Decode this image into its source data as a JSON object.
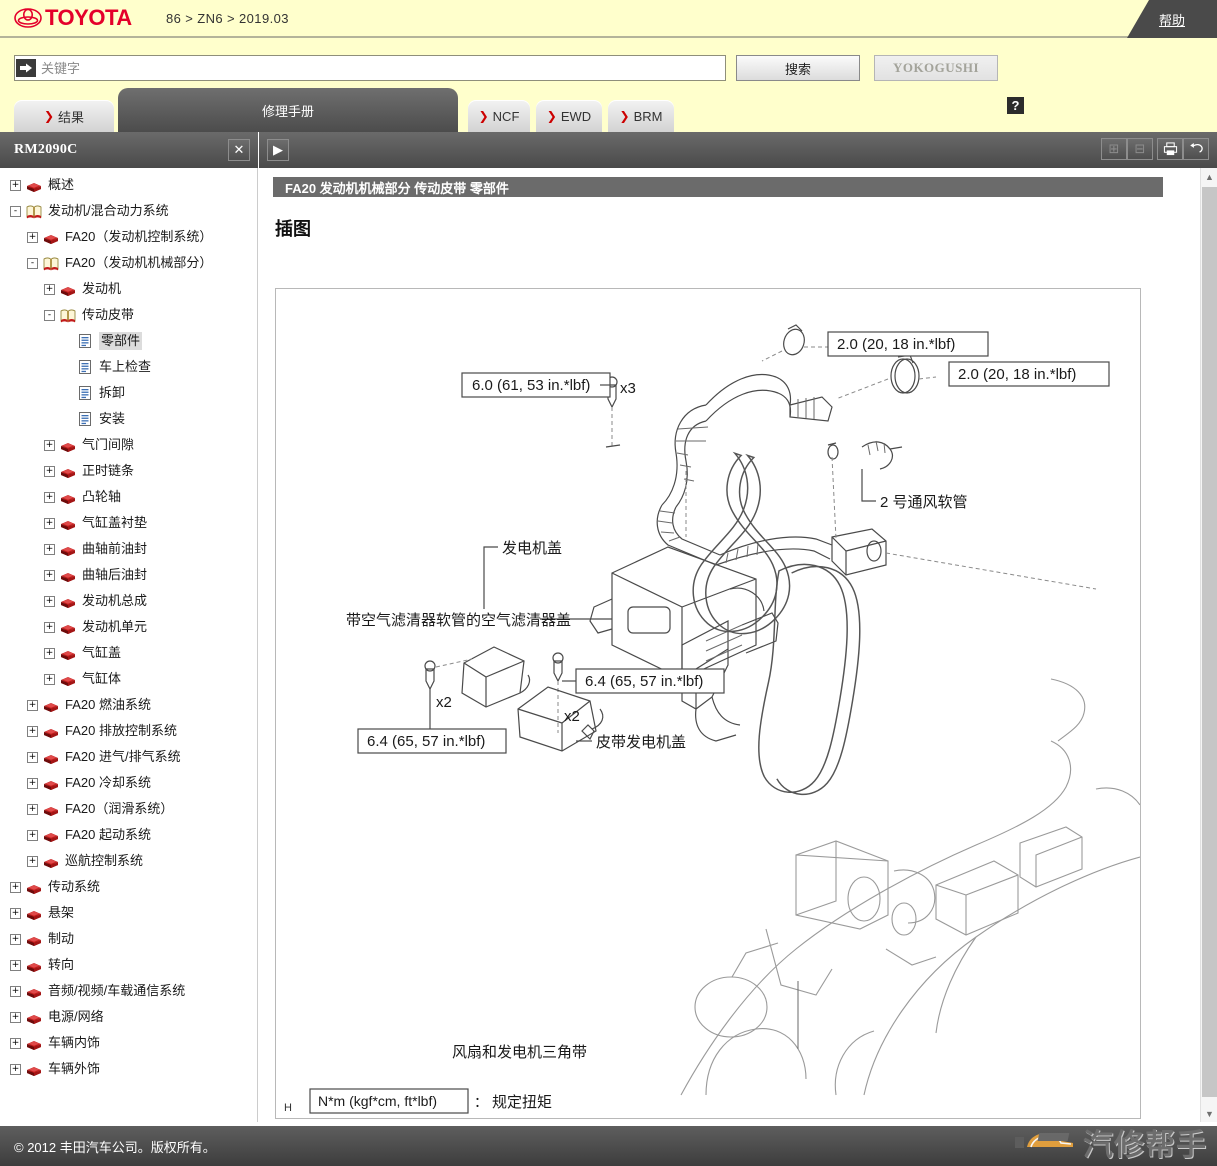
{
  "brand": {
    "logo_icon": "toyota-logo-icon",
    "name": "TOYOTA",
    "breadcrumb": "86 > ZN6 > 2019.03",
    "help_label": "帮助"
  },
  "search": {
    "arrow_icon": "arrow-right-icon",
    "value": "",
    "placeholder": "关键字",
    "search_button": "搜索",
    "yokogushi_button": "YOKOGUSHI",
    "help_button": "?"
  },
  "tabs": [
    {
      "label": "结果",
      "chevron": "❯",
      "active": false
    },
    {
      "label": "修理手册",
      "chevron": "",
      "active": true
    },
    {
      "label": "NCF",
      "chevron": "❯",
      "active": false
    },
    {
      "label": "EWD",
      "chevron": "❯",
      "active": false
    },
    {
      "label": "BRM",
      "chevron": "❯",
      "active": false
    }
  ],
  "sidebar": {
    "title": "RM2090C",
    "close_icon": "close-icon",
    "tree": [
      {
        "label": "概述",
        "indent": 0,
        "expander": "+",
        "icon": "closed-book-icon",
        "selected": false
      },
      {
        "label": "发动机/混合动力系统",
        "indent": 0,
        "expander": "-",
        "icon": "open-book-icon",
        "selected": false
      },
      {
        "label": "FA20（发动机控制系统）",
        "indent": 1,
        "expander": "+",
        "icon": "closed-book-icon",
        "selected": false
      },
      {
        "label": "FA20（发动机机械部分）",
        "indent": 1,
        "expander": "-",
        "icon": "open-book-icon",
        "selected": false
      },
      {
        "label": "发动机",
        "indent": 2,
        "expander": "+",
        "icon": "closed-book-icon",
        "selected": false
      },
      {
        "label": "传动皮带",
        "indent": 2,
        "expander": "-",
        "icon": "open-book-icon",
        "selected": false
      },
      {
        "label": "零部件",
        "indent": 3,
        "expander": "",
        "icon": "document-icon",
        "selected": true
      },
      {
        "label": "车上检查",
        "indent": 3,
        "expander": "",
        "icon": "document-icon",
        "selected": false
      },
      {
        "label": "拆卸",
        "indent": 3,
        "expander": "",
        "icon": "document-icon",
        "selected": false
      },
      {
        "label": "安装",
        "indent": 3,
        "expander": "",
        "icon": "document-icon",
        "selected": false
      },
      {
        "label": "气门间隙",
        "indent": 2,
        "expander": "+",
        "icon": "closed-book-icon",
        "selected": false
      },
      {
        "label": "正时链条",
        "indent": 2,
        "expander": "+",
        "icon": "closed-book-icon",
        "selected": false
      },
      {
        "label": "凸轮轴",
        "indent": 2,
        "expander": "+",
        "icon": "closed-book-icon",
        "selected": false
      },
      {
        "label": "气缸盖衬垫",
        "indent": 2,
        "expander": "+",
        "icon": "closed-book-icon",
        "selected": false
      },
      {
        "label": "曲轴前油封",
        "indent": 2,
        "expander": "+",
        "icon": "closed-book-icon",
        "selected": false
      },
      {
        "label": "曲轴后油封",
        "indent": 2,
        "expander": "+",
        "icon": "closed-book-icon",
        "selected": false
      },
      {
        "label": "发动机总成",
        "indent": 2,
        "expander": "+",
        "icon": "closed-book-icon",
        "selected": false
      },
      {
        "label": "发动机单元",
        "indent": 2,
        "expander": "+",
        "icon": "closed-book-icon",
        "selected": false
      },
      {
        "label": "气缸盖",
        "indent": 2,
        "expander": "+",
        "icon": "closed-book-icon",
        "selected": false
      },
      {
        "label": "气缸体",
        "indent": 2,
        "expander": "+",
        "icon": "closed-book-icon",
        "selected": false
      },
      {
        "label": "FA20 燃油系统",
        "indent": 1,
        "expander": "+",
        "icon": "closed-book-icon",
        "selected": false
      },
      {
        "label": "FA20 排放控制系统",
        "indent": 1,
        "expander": "+",
        "icon": "closed-book-icon",
        "selected": false
      },
      {
        "label": "FA20 进气/排气系统",
        "indent": 1,
        "expander": "+",
        "icon": "closed-book-icon",
        "selected": false
      },
      {
        "label": "FA20 冷却系统",
        "indent": 1,
        "expander": "+",
        "icon": "closed-book-icon",
        "selected": false
      },
      {
        "label": "FA20（润滑系统）",
        "indent": 1,
        "expander": "+",
        "icon": "closed-book-icon",
        "selected": false
      },
      {
        "label": "FA20 起动系统",
        "indent": 1,
        "expander": "+",
        "icon": "closed-book-icon",
        "selected": false
      },
      {
        "label": "巡航控制系统",
        "indent": 1,
        "expander": "+",
        "icon": "closed-book-icon",
        "selected": false
      },
      {
        "label": "传动系统",
        "indent": 0,
        "expander": "+",
        "icon": "closed-book-icon",
        "selected": false
      },
      {
        "label": "悬架",
        "indent": 0,
        "expander": "+",
        "icon": "closed-book-icon",
        "selected": false
      },
      {
        "label": "制动",
        "indent": 0,
        "expander": "+",
        "icon": "closed-book-icon",
        "selected": false
      },
      {
        "label": "转向",
        "indent": 0,
        "expander": "+",
        "icon": "closed-book-icon",
        "selected": false
      },
      {
        "label": "音频/视频/车载通信系统",
        "indent": 0,
        "expander": "+",
        "icon": "closed-book-icon",
        "selected": false
      },
      {
        "label": "电源/网络",
        "indent": 0,
        "expander": "+",
        "icon": "closed-book-icon",
        "selected": false
      },
      {
        "label": "车辆内饰",
        "indent": 0,
        "expander": "+",
        "icon": "closed-book-icon",
        "selected": false
      },
      {
        "label": "车辆外饰",
        "indent": 0,
        "expander": "+",
        "icon": "closed-book-icon",
        "selected": false
      }
    ]
  },
  "content_toolbar": {
    "show_panel_icon": "play-right-icon",
    "expand_all_icon": "expand-all-icon",
    "collapse_all_icon": "collapse-all-icon",
    "print_icon": "print-icon",
    "back_icon": "back-arrow-icon"
  },
  "document": {
    "breadcrumb": "FA20 发动机机械部分  传动皮带  零部件",
    "heading": "插图",
    "figure_corner_mark": "H",
    "callouts": [
      {
        "id": "torque-air-cleaner-bolts",
        "text": "6.0 (61, 53 in.*lbf)",
        "boxed": true
      },
      {
        "id": "qty-air-cleaner-bolts",
        "text": "x3",
        "boxed": false
      },
      {
        "id": "torque-clamp-upper",
        "text": "2.0 (20, 18 in.*lbf)",
        "boxed": true
      },
      {
        "id": "torque-clamp-lower",
        "text": "2.0 (20, 18 in.*lbf)",
        "boxed": true
      },
      {
        "id": "label-air-cleaner-cap",
        "text": "带空气滤清器软管的空气滤清器盖",
        "boxed": false
      },
      {
        "id": "label-no2-ventilation-hose",
        "text": "2 号通风软管",
        "boxed": false
      },
      {
        "id": "label-generator-cover",
        "text": "发电机盖",
        "boxed": false
      },
      {
        "id": "qty-generator-cover-bolts",
        "text": "x2",
        "boxed": false
      },
      {
        "id": "torque-generator-cover",
        "text": "6.4 (65, 57 in.*lbf)",
        "boxed": true
      },
      {
        "id": "qty-belt-generator-cover-bolts",
        "text": "x2",
        "boxed": false
      },
      {
        "id": "torque-belt-generator-cover",
        "text": "6.4 (65, 57 in.*lbf)",
        "boxed": true
      },
      {
        "id": "label-belt-generator-cover",
        "text": "皮带发电机盖",
        "boxed": false
      },
      {
        "id": "label-fan-and-generator-v-belt",
        "text": "风扇和发电机三角带",
        "boxed": false
      }
    ],
    "legend": {
      "unit_box": "N*m (kgf*cm, ft*lbf)",
      "separator": "：",
      "meaning": "规定扭矩"
    }
  },
  "scrollbar": {
    "up_icon": "chevron-up-icon",
    "down_icon": "chevron-down-icon"
  },
  "footer": {
    "copyright": "© 2012 丰田汽车公司。版权所有。",
    "watermark_text": "汽修帮手",
    "watermark_icon": "car-logo-icon"
  },
  "colors": {
    "brand_red": "#e4002b",
    "page_yellow": "#ffffcc",
    "toolbar_dark": "#4a4a4a",
    "accent_chevron": "#cc0000"
  }
}
